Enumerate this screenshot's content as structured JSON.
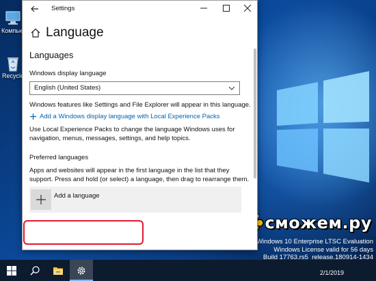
{
  "window": {
    "title": "Settings",
    "page_title": "Language"
  },
  "languages": {
    "section_title": "Languages",
    "display_label": "Windows display language",
    "display_value": "English (United States)",
    "display_note": "Windows features like Settings and File Explorer will appear in this language.",
    "lxp_link": "Add a Windows display language with Local Experience Packs",
    "lxp_note": "Use Local Experience Packs to change the language Windows uses for navigation, menus, messages, settings, and help topics.",
    "preferred_title": "Preferred languages",
    "preferred_note": "Apps and websites will appear in the first language in the list that they support. Press and hold (or select) a language, then drag to rearrange them.",
    "add_label": "Add a language"
  },
  "desktop": {
    "icons": [
      {
        "label": "Компьют",
        "icon": "computer-icon"
      },
      {
        "label": "Recycle",
        "icon": "recycle-bin-icon"
      }
    ],
    "license_lines": [
      "Windows 10 Enterprise LTSC Evaluation",
      "Windows License valid for 56 days",
      "Build 17763.rs5_release.180914-1434"
    ],
    "watermark": "сможем.ру"
  },
  "taskbar": {
    "items": [
      "start-icon",
      "search-icon",
      "file-explorer-icon",
      "settings-icon"
    ],
    "date": "2/1/2019"
  },
  "colors": {
    "link": "#0063b1",
    "highlight": "#e0192b",
    "taskbar": "#0d1b2e"
  }
}
